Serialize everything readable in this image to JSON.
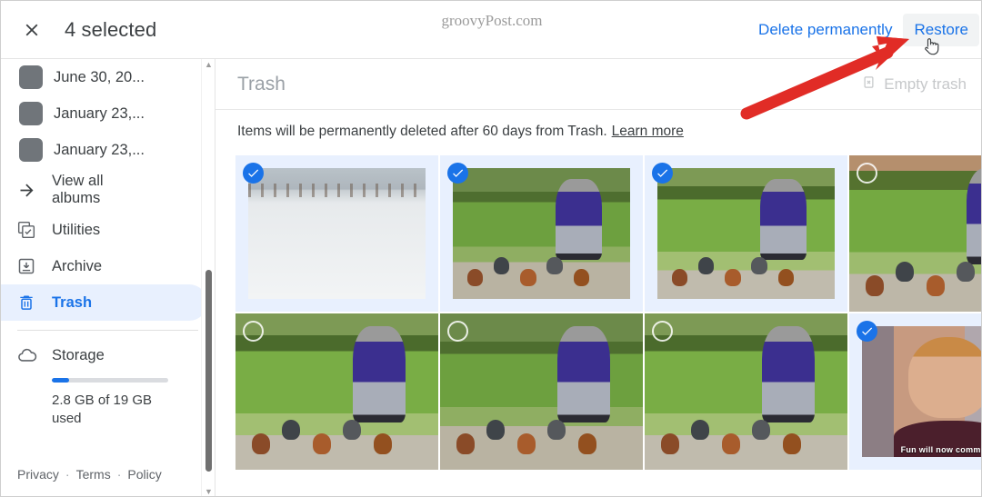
{
  "topbar": {
    "close_icon": "close-icon",
    "selected_label": "4 selected",
    "watermark": "groovyPost.com",
    "delete_permanently_label": "Delete permanently",
    "restore_label": "Restore"
  },
  "sidebar": {
    "albums": [
      {
        "label": "June 30, 20...",
        "icon": "album-thumbnail-icon"
      },
      {
        "label": "January 23,...",
        "icon": "album-thumbnail-icon"
      },
      {
        "label": "January 23,...",
        "icon": "album-thumbnail-icon"
      }
    ],
    "view_all_albums_label": "View all albums",
    "view_all_albums_icon": "arrow-right-icon",
    "nav_items": [
      {
        "label": "Utilities",
        "icon": "utilities-icon",
        "active": false
      },
      {
        "label": "Archive",
        "icon": "archive-icon",
        "active": false
      },
      {
        "label": "Trash",
        "icon": "trash-icon",
        "active": true
      }
    ],
    "storage": {
      "label": "Storage",
      "icon": "cloud-icon",
      "usage_text": "2.8 GB of 19 GB used",
      "used_percent": 15,
      "bar_color": "#1a73e8"
    },
    "footer": {
      "privacy": "Privacy",
      "separator1": "·",
      "terms": "Terms",
      "separator2": "·",
      "policy": "Policy"
    }
  },
  "main": {
    "title": "Trash",
    "empty_trash_label": "Empty trash",
    "empty_trash_icon": "empty-trash-icon",
    "empty_trash_disabled": true,
    "notice_text": "Items will be permanently deleted after 60 days from Trash.",
    "notice_link": "Learn more",
    "grid": [
      {
        "name": "snowy-field-photo",
        "scene": "ph-snow",
        "selected": true,
        "caption": ""
      },
      {
        "name": "woman-feeding-chickens-1",
        "scene": "ph-yard",
        "selected": true,
        "caption": ""
      },
      {
        "name": "woman-feeding-chickens-2",
        "scene": "ph-yard3",
        "selected": true,
        "caption": ""
      },
      {
        "name": "woman-feeding-chickens-3",
        "scene": "ph-yard2",
        "selected": false,
        "caption": ""
      },
      {
        "name": "woman-feeding-chickens-4",
        "scene": "ph-yard3",
        "selected": false,
        "caption": ""
      },
      {
        "name": "woman-feeding-chickens-5",
        "scene": "ph-yard",
        "selected": false,
        "caption": ""
      },
      {
        "name": "woman-feeding-chickens-6",
        "scene": "ph-yard3",
        "selected": false,
        "caption": ""
      },
      {
        "name": "tv-show-meme-photo",
        "scene": "ph-meme",
        "selected": true,
        "caption": "Fun will now commence"
      }
    ]
  },
  "annotation": {
    "arrow_color": "#e12c26",
    "arrow_target": "restore-button"
  },
  "colors": {
    "accent": "#1a73e8",
    "selected_tile_bg": "#e8f0fe",
    "muted_text": "#9aa0a6"
  }
}
